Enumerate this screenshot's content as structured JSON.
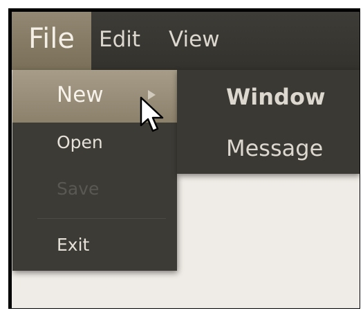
{
  "menubar": {
    "items": [
      {
        "label": "File",
        "active": true
      },
      {
        "label": "Edit",
        "active": false
      },
      {
        "label": "View",
        "active": false
      }
    ]
  },
  "file_menu": {
    "items": [
      {
        "label": "New",
        "highlighted": true,
        "has_submenu": true,
        "enabled": true
      },
      {
        "label": "Open",
        "highlighted": false,
        "has_submenu": false,
        "enabled": true
      },
      {
        "label": "Save",
        "highlighted": false,
        "has_submenu": false,
        "enabled": false
      },
      {
        "label": "Exit",
        "highlighted": false,
        "has_submenu": false,
        "enabled": true
      }
    ]
  },
  "new_submenu": {
    "items": [
      {
        "label": "Window"
      },
      {
        "label": "Message"
      }
    ]
  },
  "icons": {
    "submenu_indicator": "triangle-right-icon",
    "pointer": "mouse-cursor-icon"
  },
  "colors": {
    "menubar_bg": "#3e3c37",
    "menu_bg": "#3d3b36",
    "highlight": "#998f7a",
    "window_bg": "#efebe6",
    "text": "#e6e2da",
    "disabled_text": "#5a5852"
  }
}
